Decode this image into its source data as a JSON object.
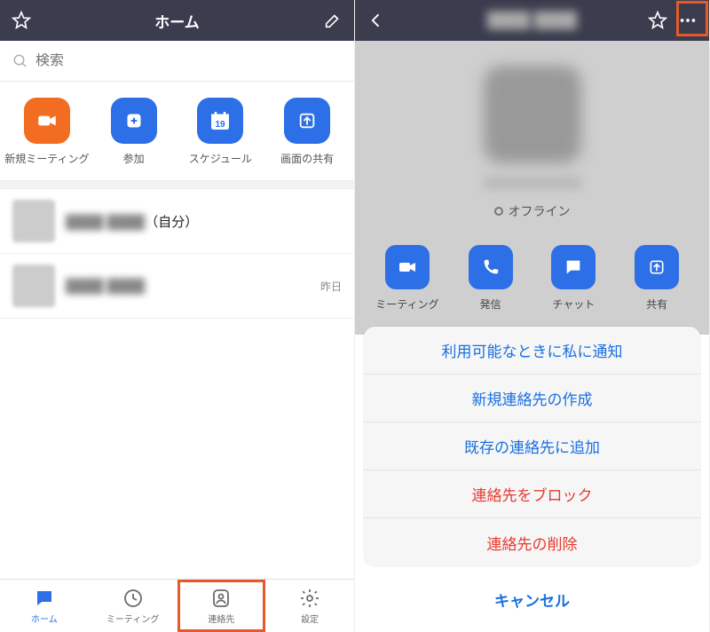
{
  "left": {
    "header": {
      "title": "ホーム"
    },
    "search": {
      "placeholder": "検索"
    },
    "tiles": [
      {
        "label": "新規ミーティング",
        "color": "orange",
        "icon": "video"
      },
      {
        "label": "参加",
        "color": "blue",
        "icon": "plus"
      },
      {
        "label": "スケジュール",
        "color": "blue",
        "icon": "calendar",
        "calendar_day": "19"
      },
      {
        "label": "画面の共有",
        "color": "blue",
        "icon": "share"
      }
    ],
    "list": [
      {
        "suffix": "（自分）"
      },
      {
        "meta": "昨日"
      }
    ],
    "tabs": [
      {
        "label": "ホーム",
        "icon": "chat",
        "active": true
      },
      {
        "label": "ミーティング",
        "icon": "clock",
        "active": false
      },
      {
        "label": "連絡先",
        "icon": "contact",
        "active": false,
        "highlight": true
      },
      {
        "label": "設定",
        "icon": "gear",
        "active": false
      }
    ]
  },
  "right": {
    "status": "オフライン",
    "actions": [
      {
        "label": "ミーティング",
        "icon": "video"
      },
      {
        "label": "発信",
        "icon": "phone"
      },
      {
        "label": "チャット",
        "icon": "chat"
      },
      {
        "label": "共有",
        "icon": "share"
      }
    ],
    "sheet": [
      {
        "label": "利用可能なときに私に通知",
        "style": "blue"
      },
      {
        "label": "新規連絡先の作成",
        "style": "blue"
      },
      {
        "label": "既存の連絡先に追加",
        "style": "blue"
      },
      {
        "label": "連絡先をブロック",
        "style": "red"
      },
      {
        "label": "連絡先の削除",
        "style": "red"
      }
    ],
    "cancel": "キャンセル"
  }
}
